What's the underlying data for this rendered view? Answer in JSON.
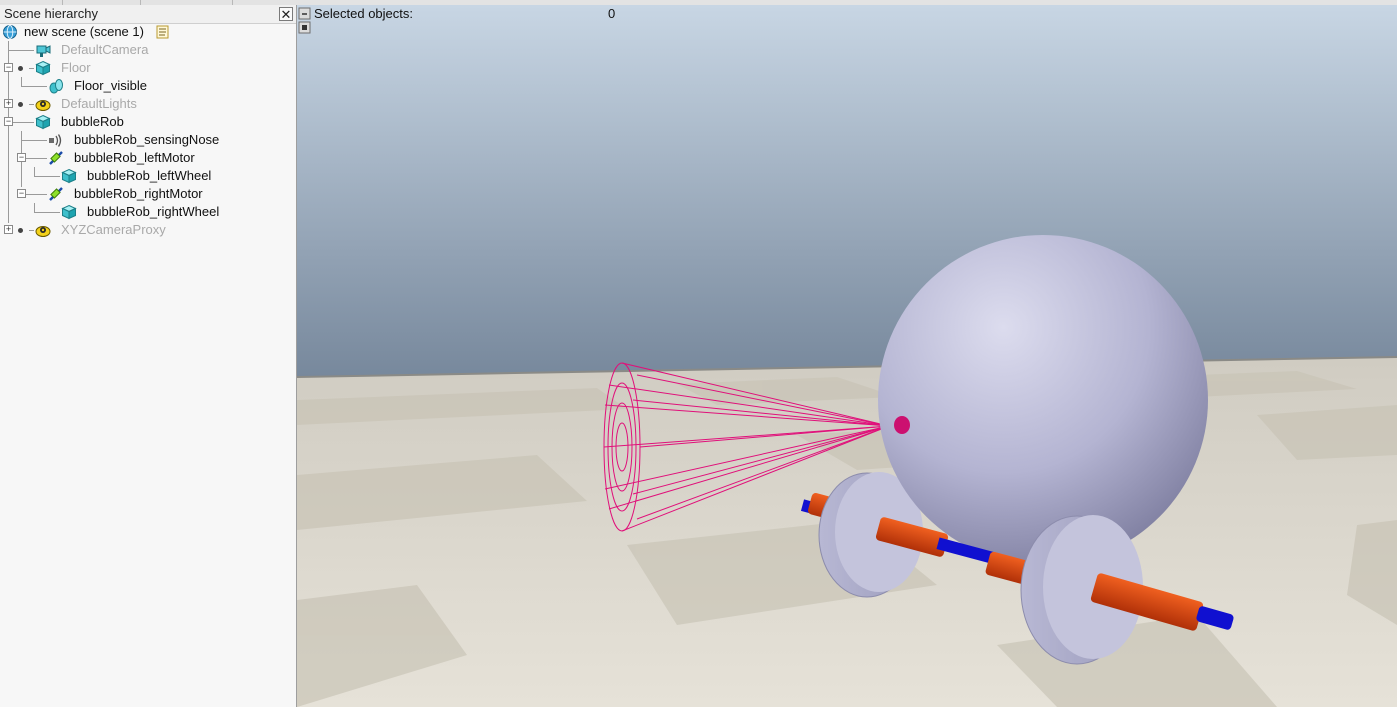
{
  "panel": {
    "title": "Scene hierarchy",
    "close_glyph": "✕"
  },
  "tree": [
    {
      "label": "new scene (scene 1)",
      "icon": "globe-icon",
      "dim": false
    },
    {
      "label": "DefaultCamera",
      "icon": "camera-icon",
      "dim": true
    },
    {
      "label": "Floor",
      "icon": "cube-icon",
      "dim": true
    },
    {
      "label": "Floor_visible",
      "icon": "shape-icon",
      "dim": false
    },
    {
      "label": "DefaultLights",
      "icon": "dummy-icon",
      "dim": true
    },
    {
      "label": "bubbleRob",
      "icon": "cube-icon",
      "dim": false
    },
    {
      "label": "bubbleRob_sensingNose",
      "icon": "proximity-sensor-icon",
      "dim": false
    },
    {
      "label": "bubbleRob_leftMotor",
      "icon": "joint-icon",
      "dim": false
    },
    {
      "label": "bubbleRob_leftWheel",
      "icon": "cube-icon",
      "dim": false
    },
    {
      "label": "bubbleRob_rightMotor",
      "icon": "joint-icon",
      "dim": false
    },
    {
      "label": "bubbleRob_rightWheel",
      "icon": "cube-icon",
      "dim": false
    },
    {
      "label": "XYZCameraProxy",
      "icon": "dummy-icon",
      "dim": true
    }
  ],
  "viewport": {
    "selected_label": "Selected objects:",
    "selected_count": "0"
  },
  "colors": {
    "sky_top": "#c8d6e4",
    "sky_bottom": "#77889c",
    "floor": "#ddd8cc",
    "sphere": "#b8b8d4",
    "sensor_cone": "#e0107a",
    "motor": "#e04010",
    "axle": "#1010d0"
  }
}
